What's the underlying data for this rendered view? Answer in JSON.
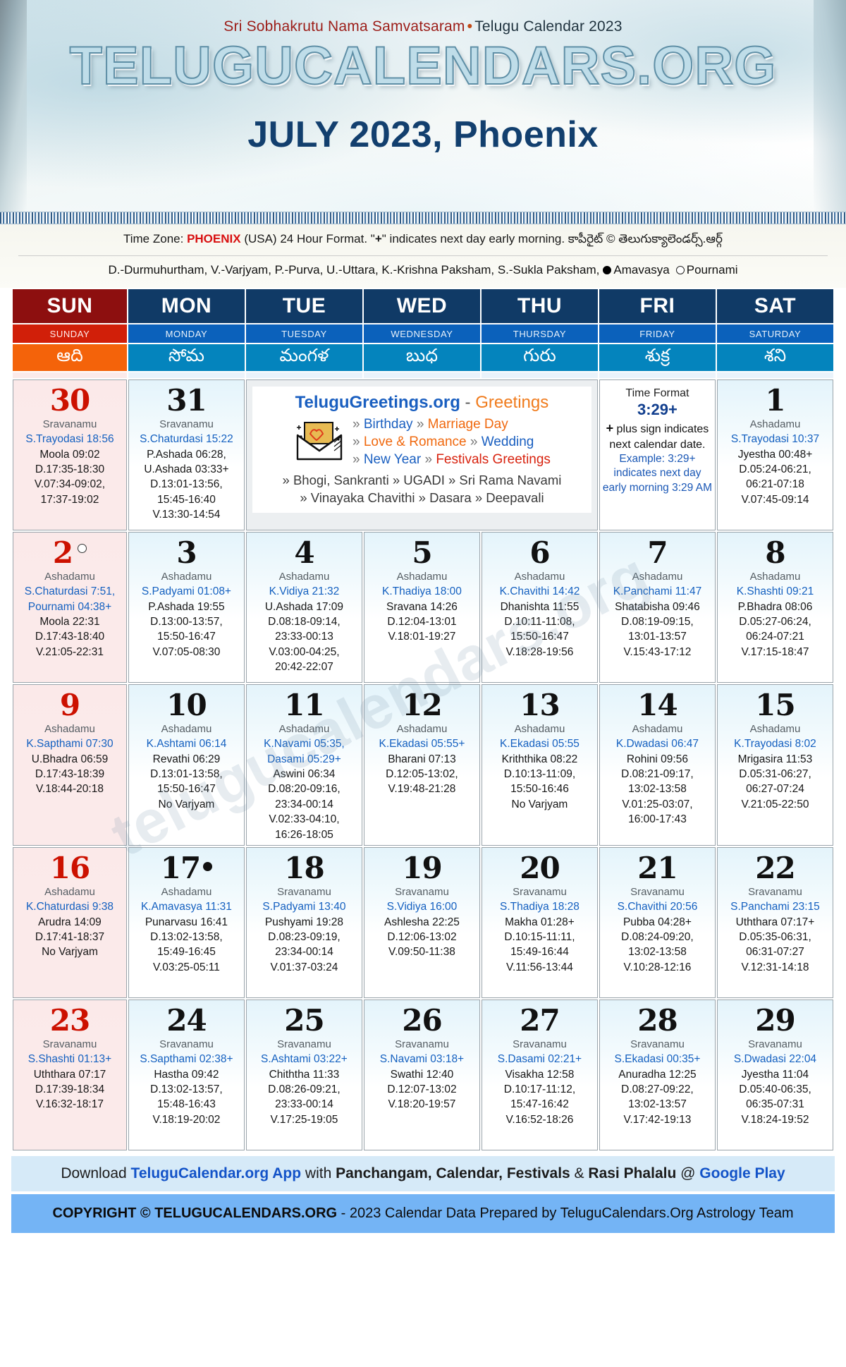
{
  "header": {
    "samvatsaram_red": "Sri Sobhakrutu Nama Samvatsaram",
    "bullet": "•",
    "samvatsaram_dark": "Telugu Calendar 2023",
    "site_logo": "TELUGUCALENDARS.ORG",
    "month_title": "JULY 2023, Phoenix"
  },
  "info": {
    "tz_prefix": "Time Zone: ",
    "tz_city": "PHOENIX",
    "tz_suffix_a": " (USA) 24 Hour Format. \"",
    "tz_plus": "+",
    "tz_suffix_b": "\" indicates next day early morning. ",
    "tz_telugu": "కాపీరైట్ © తెలుగుక్యాలెండర్స్.ఆర్గ్",
    "legend": "D.-Durmuhurtham, V.-Varjyam, P.-Purva, U.-Uttara, K.-Krishna Paksham, S.-Sukla Paksham,",
    "legend_amavasya": "Amavasya",
    "legend_pournami": "Pournami"
  },
  "weekdays": [
    {
      "short": "SUN",
      "long": "SUNDAY",
      "telugu": "ఆది"
    },
    {
      "short": "MON",
      "long": "MONDAY",
      "telugu": "సోమ"
    },
    {
      "short": "TUE",
      "long": "TUESDAY",
      "telugu": "మంగళ"
    },
    {
      "short": "WED",
      "long": "WEDNESDAY",
      "telugu": "బుధ"
    },
    {
      "short": "THU",
      "long": "THURSDAY",
      "telugu": "గురు"
    },
    {
      "short": "FRI",
      "long": "FRIDAY",
      "telugu": "శుక్ర"
    },
    {
      "short": "SAT",
      "long": "SATURDAY",
      "telugu": "శని"
    }
  ],
  "promo": {
    "title_main": "TeluguGreetings.org",
    "title_dash": " - ",
    "title_greetings": "Greetings",
    "icon": "envelope-with-heart-icon",
    "line1": [
      {
        "t": "» ",
        "c": "g"
      },
      {
        "t": "Birthday ",
        "c": "b"
      },
      {
        "t": "» ",
        "c": "g"
      },
      {
        "t": "Marriage Day",
        "c": "o"
      }
    ],
    "line2": [
      {
        "t": "» ",
        "c": "g"
      },
      {
        "t": "Love & Romance ",
        "c": "o"
      },
      {
        "t": "» ",
        "c": "g"
      },
      {
        "t": "Wedding",
        "c": "b"
      }
    ],
    "line3": [
      {
        "t": "» ",
        "c": "g"
      },
      {
        "t": "New Year ",
        "c": "b"
      },
      {
        "t": "» ",
        "c": "g"
      },
      {
        "t": "Festivals Greetings",
        "c": "r"
      }
    ],
    "footer1": "» Bhogi, Sankranti » UGADI » Sri Rama Navami",
    "footer2": "» Vinayaka Chavithi » Dasara » Deepavali"
  },
  "time_format_box": {
    "title": "Time Format",
    "sample": "3:29+",
    "plus": "+",
    "desc": " plus sign indicates next calendar date.",
    "example": "Example: 3:29+ indicates next day early morning 3:29 AM"
  },
  "weeks": [
    [
      {
        "type": "day",
        "num": "30",
        "sunday": true,
        "masa": "Sravanamu",
        "tithi": "S.Trayodasi 18:56",
        "lines": [
          "Moola 09:02",
          "D.17:35-18:30",
          "V.07:34-09:02,",
          "17:37-19:02"
        ]
      },
      {
        "type": "day",
        "num": "31",
        "masa": "Sravanamu",
        "tithi": "S.Chaturdasi 15:22",
        "lines": [
          "P.Ashada 06:28,",
          "U.Ashada 03:33+",
          "D.13:01-13:56,",
          "15:45-16:40",
          "V.13:30-14:54"
        ]
      },
      {
        "type": "promo",
        "colspan": 3
      },
      {
        "type": "timeformat"
      },
      {
        "type": "day",
        "num": "1",
        "masa": "Ashadamu",
        "tithi": "S.Trayodasi 10:37",
        "lines": [
          "Jyestha 00:48+",
          "D.05:24-06:21,",
          "06:21-07:18",
          "V.07:45-09:14"
        ]
      }
    ],
    [
      {
        "type": "day",
        "num": "2",
        "sunday": true,
        "moon": "full",
        "masa": "Ashadamu",
        "tithi": "S.Chaturdasi 7:51,\nPournami 04:38+",
        "lines": [
          "Moola 22:31",
          "D.17:43-18:40",
          "V.21:05-22:31"
        ]
      },
      {
        "type": "day",
        "num": "3",
        "masa": "Ashadamu",
        "tithi": "S.Padyami 01:08+",
        "lines": [
          "P.Ashada 19:55",
          "D.13:00-13:57,",
          "15:50-16:47",
          "V.07:05-08:30"
        ]
      },
      {
        "type": "day",
        "num": "4",
        "masa": "Ashadamu",
        "tithi": "K.Vidiya 21:32",
        "lines": [
          "U.Ashada 17:09",
          "D.08:18-09:14,",
          "23:33-00:13",
          "V.03:00-04:25,",
          "20:42-22:07"
        ]
      },
      {
        "type": "day",
        "num": "5",
        "masa": "Ashadamu",
        "tithi": "K.Thadiya 18:00",
        "lines": [
          "Sravana 14:26",
          "D.12:04-13:01",
          "V.18:01-19:27"
        ]
      },
      {
        "type": "day",
        "num": "6",
        "masa": "Ashadamu",
        "tithi": "K.Chavithi 14:42",
        "lines": [
          "Dhanishta 11:55",
          "D.10:11-11:08,",
          "15:50-16:47",
          "V.18:28-19:56"
        ]
      },
      {
        "type": "day",
        "num": "7",
        "masa": "Ashadamu",
        "tithi": "K.Panchami 11:47",
        "lines": [
          "Shatabisha 09:46",
          "D.08:19-09:15,",
          "13:01-13:57",
          "V.15:43-17:12"
        ]
      },
      {
        "type": "day",
        "num": "8",
        "masa": "Ashadamu",
        "tithi": "K.Shashti 09:21",
        "lines": [
          "P.Bhadra 08:06",
          "D.05:27-06:24,",
          "06:24-07:21",
          "V.17:15-18:47"
        ]
      }
    ],
    [
      {
        "type": "day",
        "num": "9",
        "sunday": true,
        "masa": "Ashadamu",
        "tithi": "K.Sapthami 07:30",
        "lines": [
          "U.Bhadra 06:59",
          "D.17:43-18:39",
          "V.18:44-20:18"
        ]
      },
      {
        "type": "day",
        "num": "10",
        "masa": "Ashadamu",
        "tithi": "K.Ashtami 06:14",
        "lines": [
          "Revathi 06:29",
          "D.13:01-13:58,",
          "15:50-16:47",
          "No Varjyam"
        ]
      },
      {
        "type": "day",
        "num": "11",
        "masa": "Ashadamu",
        "tithi": "K.Navami 05:35,\nDasami 05:29+",
        "lines": [
          "Aswini 06:34",
          "D.08:20-09:16,",
          "23:34-00:14",
          "V.02:33-04:10,",
          "16:26-18:05"
        ]
      },
      {
        "type": "day",
        "num": "12",
        "masa": "Ashadamu",
        "tithi": "K.Ekadasi 05:55+",
        "lines": [
          "Bharani 07:13",
          "D.12:05-13:02,",
          "V.19:48-21:28"
        ]
      },
      {
        "type": "day",
        "num": "13",
        "masa": "Ashadamu",
        "tithi": "K.Ekadasi 05:55",
        "lines": [
          "Kriththika 08:22",
          "D.10:13-11:09,",
          "15:50-16:46",
          "No Varjyam"
        ]
      },
      {
        "type": "day",
        "num": "14",
        "masa": "Ashadamu",
        "tithi": "K.Dwadasi 06:47",
        "lines": [
          "Rohini 09:56",
          "D.08:21-09:17,",
          "13:02-13:58",
          "V.01:25-03:07,",
          "16:00-17:43"
        ]
      },
      {
        "type": "day",
        "num": "15",
        "masa": "Ashadamu",
        "tithi": "K.Trayodasi 8:02",
        "lines": [
          "Mrigasira 11:53",
          "D.05:31-06:27,",
          "06:27-07:24",
          "V.21:05-22:50"
        ]
      }
    ],
    [
      {
        "type": "day",
        "num": "16",
        "sunday": true,
        "masa": "Ashadamu",
        "tithi": "K.Chaturdasi 9:38",
        "lines": [
          "Arudra 14:09",
          "D.17:41-18:37",
          "No Varjyam"
        ]
      },
      {
        "type": "day",
        "num": "17",
        "moon": "new",
        "masa": "Ashadamu",
        "tithi": "K.Amavasya 11:31",
        "lines": [
          "Punarvasu 16:41",
          "D.13:02-13:58,",
          "15:49-16:45",
          "V.03:25-05:11"
        ]
      },
      {
        "type": "day",
        "num": "18",
        "masa": "Sravanamu",
        "tithi": "S.Padyami 13:40",
        "lines": [
          "Pushyami 19:28",
          "D.08:23-09:19,",
          "23:34-00:14",
          "V.01:37-03:24"
        ]
      },
      {
        "type": "day",
        "num": "19",
        "masa": "Sravanamu",
        "tithi": "S.Vidiya 16:00",
        "lines": [
          "Ashlesha 22:25",
          "D.12:06-13:02",
          "V.09:50-11:38"
        ]
      },
      {
        "type": "day",
        "num": "20",
        "masa": "Sravanamu",
        "tithi": "S.Thadiya 18:28",
        "lines": [
          "Makha 01:28+",
          "D.10:15-11:11,",
          "15:49-16:44",
          "V.11:56-13:44"
        ]
      },
      {
        "type": "day",
        "num": "21",
        "masa": "Sravanamu",
        "tithi": "S.Chavithi 20:56",
        "lines": [
          "Pubba 04:28+",
          "D.08:24-09:20,",
          "13:02-13:58",
          "V.10:28-12:16"
        ]
      },
      {
        "type": "day",
        "num": "22",
        "masa": "Sravanamu",
        "tithi": "S.Panchami 23:15",
        "lines": [
          "Uththara 07:17+",
          "D.05:35-06:31,",
          "06:31-07:27",
          "V.12:31-14:18"
        ]
      }
    ],
    [
      {
        "type": "day",
        "num": "23",
        "sunday": true,
        "masa": "Sravanamu",
        "tithi": "S.Shashti 01:13+",
        "lines": [
          "Uththara 07:17",
          "D.17:39-18:34",
          "V.16:32-18:17"
        ]
      },
      {
        "type": "day",
        "num": "24",
        "masa": "Sravanamu",
        "tithi": "S.Sapthami 02:38+",
        "lines": [
          "Hastha 09:42",
          "D.13:02-13:57,",
          "15:48-16:43",
          "V.18:19-20:02"
        ]
      },
      {
        "type": "day",
        "num": "25",
        "masa": "Sravanamu",
        "tithi": "S.Ashtami 03:22+",
        "lines": [
          "Chiththa 11:33",
          "D.08:26-09:21,",
          "23:33-00:14",
          "V.17:25-19:05"
        ]
      },
      {
        "type": "day",
        "num": "26",
        "masa": "Sravanamu",
        "tithi": "S.Navami 03:18+",
        "lines": [
          "Swathi 12:40",
          "D.12:07-13:02",
          "V.18:20-19:57"
        ]
      },
      {
        "type": "day",
        "num": "27",
        "masa": "Sravanamu",
        "tithi": "S.Dasami 02:21+",
        "lines": [
          "Visakha 12:58",
          "D.10:17-11:12,",
          "15:47-16:42",
          "V.16:52-18:26"
        ]
      },
      {
        "type": "day",
        "num": "28",
        "masa": "Sravanamu",
        "tithi": "S.Ekadasi 00:35+",
        "lines": [
          "Anuradha 12:25",
          "D.08:27-09:22,",
          "13:02-13:57",
          "V.17:42-19:13"
        ]
      },
      {
        "type": "day",
        "num": "29",
        "masa": "Sravanamu",
        "tithi": "S.Dwadasi 22:04",
        "lines": [
          "Jyestha 11:04",
          "D.05:40-06:35,",
          "06:35-07:31",
          "V.18:24-19:52"
        ]
      }
    ]
  ],
  "footer": {
    "download_pre": "Download ",
    "download_app": "TeluguCalendar.org App",
    "download_with": " with ",
    "download_items": "Panchangam, Calendar, Festivals",
    "download_amp": " & ",
    "download_rasi": "Rasi Phalalu",
    "download_at": " @ ",
    "download_store": "Google Play",
    "copyright_bold": "COPYRIGHT © TELUGUCALENDARS.ORG",
    "copyright_rest": " - 2023 Calendar Data Prepared by TeluguCalendars.Org Astrology Team"
  },
  "watermark": "telugucalendars.org"
}
